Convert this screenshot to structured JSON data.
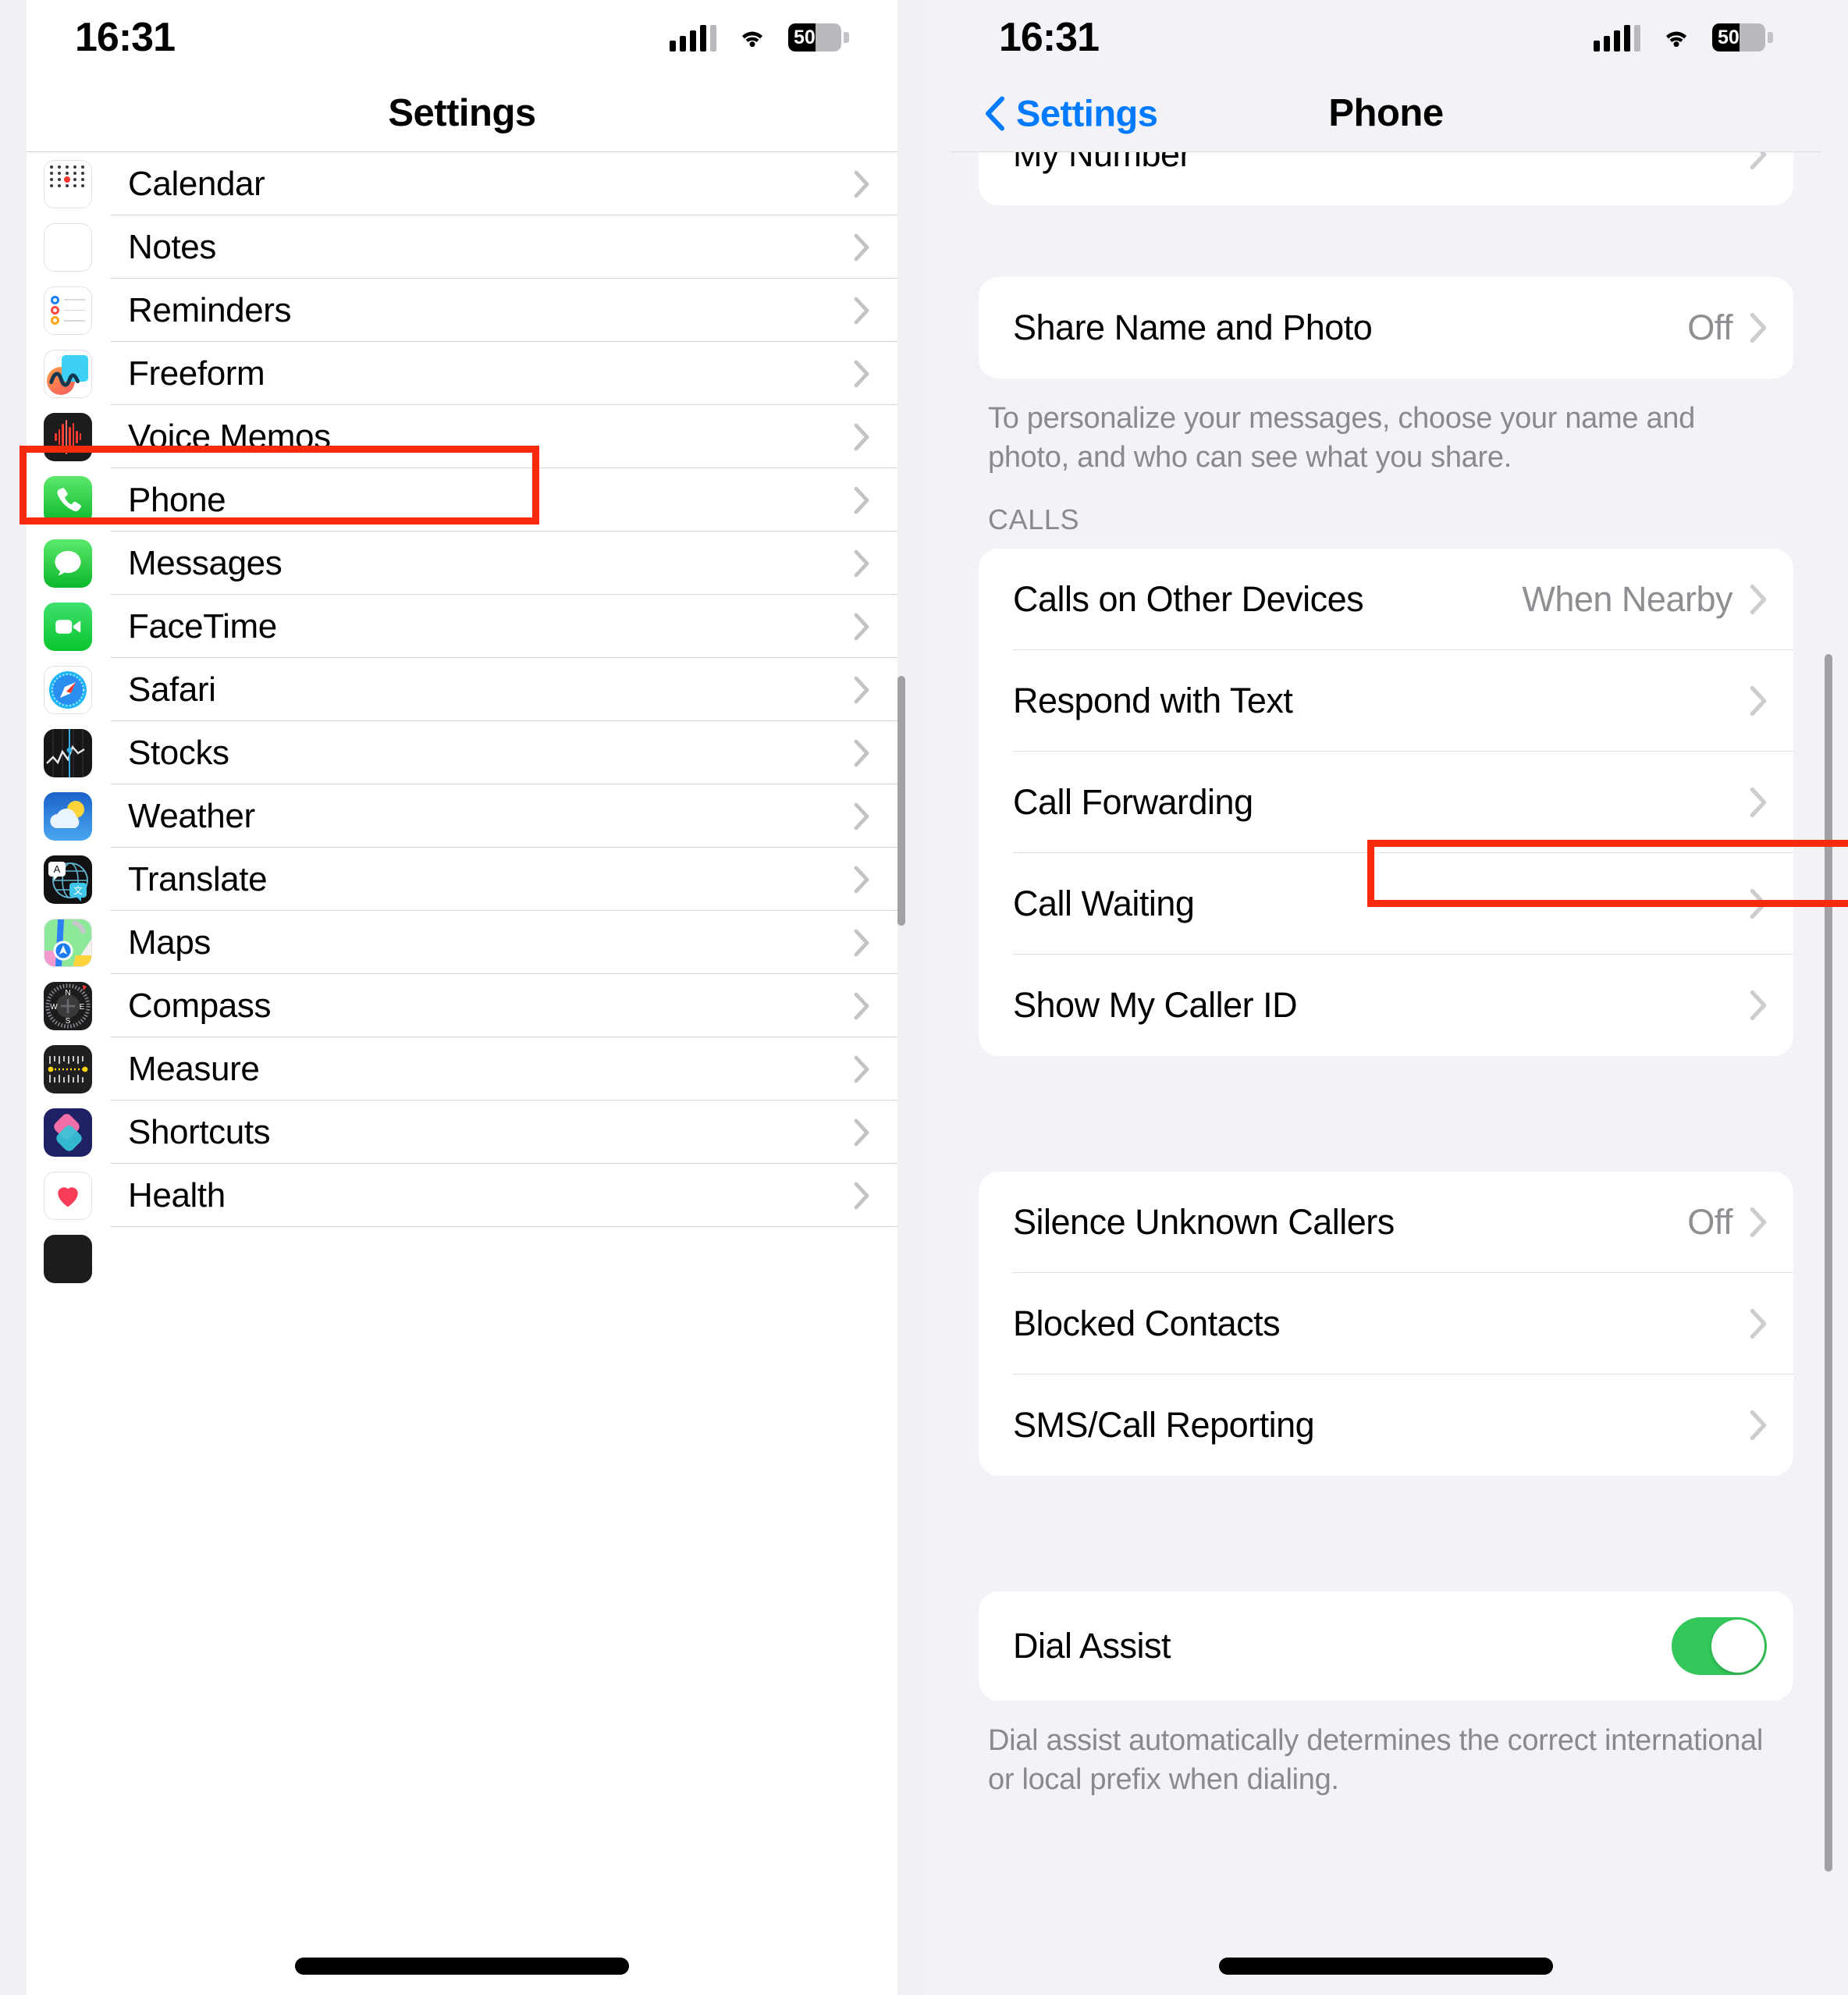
{
  "status_bar": {
    "time": "16:31",
    "battery_percent": "50",
    "cellular_icon": "cellular-bars-icon",
    "wifi_icon": "wifi-icon",
    "battery_icon": "battery-icon"
  },
  "left_screen": {
    "nav_title": "Settings",
    "items": [
      {
        "label": "Calendar",
        "icon": "calendar-app-icon"
      },
      {
        "label": "Notes",
        "icon": "notes-app-icon"
      },
      {
        "label": "Reminders",
        "icon": "reminders-app-icon"
      },
      {
        "label": "Freeform",
        "icon": "freeform-app-icon"
      },
      {
        "label": "Voice Memos",
        "icon": "voice-memos-app-icon"
      },
      {
        "label": "Phone",
        "icon": "phone-app-icon",
        "highlighted": true
      },
      {
        "label": "Messages",
        "icon": "messages-app-icon"
      },
      {
        "label": "FaceTime",
        "icon": "facetime-app-icon"
      },
      {
        "label": "Safari",
        "icon": "safari-app-icon"
      },
      {
        "label": "Stocks",
        "icon": "stocks-app-icon"
      },
      {
        "label": "Weather",
        "icon": "weather-app-icon"
      },
      {
        "label": "Translate",
        "icon": "translate-app-icon"
      },
      {
        "label": "Maps",
        "icon": "maps-app-icon"
      },
      {
        "label": "Compass",
        "icon": "compass-app-icon"
      },
      {
        "label": "Measure",
        "icon": "measure-app-icon"
      },
      {
        "label": "Shortcuts",
        "icon": "shortcuts-app-icon"
      },
      {
        "label": "Health",
        "icon": "health-app-icon"
      }
    ]
  },
  "right_screen": {
    "nav_title": "Phone",
    "back_label": "Settings",
    "back_icon": "chevron-left-icon",
    "rows": {
      "my_number": {
        "label": "My Number"
      },
      "share_name_photo": {
        "label": "Share Name and Photo",
        "value": "Off"
      },
      "share_footnote": "To personalize your messages, choose your name and photo, and who can see what you share.",
      "calls_header": "CALLS",
      "calls_on_other_devices": {
        "label": "Calls on Other Devices",
        "value": "When Nearby"
      },
      "respond_with_text": {
        "label": "Respond with Text"
      },
      "call_forwarding": {
        "label": "Call Forwarding"
      },
      "call_waiting": {
        "label": "Call Waiting"
      },
      "show_my_caller_id": {
        "label": "Show My Caller ID"
      },
      "silence_unknown_callers": {
        "label": "Silence Unknown Callers",
        "value": "Off"
      },
      "blocked_contacts": {
        "label": "Blocked Contacts",
        "highlighted": true
      },
      "sms_call_reporting": {
        "label": "SMS/Call Reporting"
      },
      "dial_assist": {
        "label": "Dial Assist",
        "toggle_on": true
      },
      "dial_assist_footnote": "Dial assist automatically determines the correct international or local prefix when dialing."
    }
  },
  "colors": {
    "accent_blue": "#007aff",
    "toggle_green": "#34c759",
    "highlight_red": "#f72a0c",
    "group_bg": "#f2f2f7",
    "secondary_text": "#8a8a8e"
  }
}
